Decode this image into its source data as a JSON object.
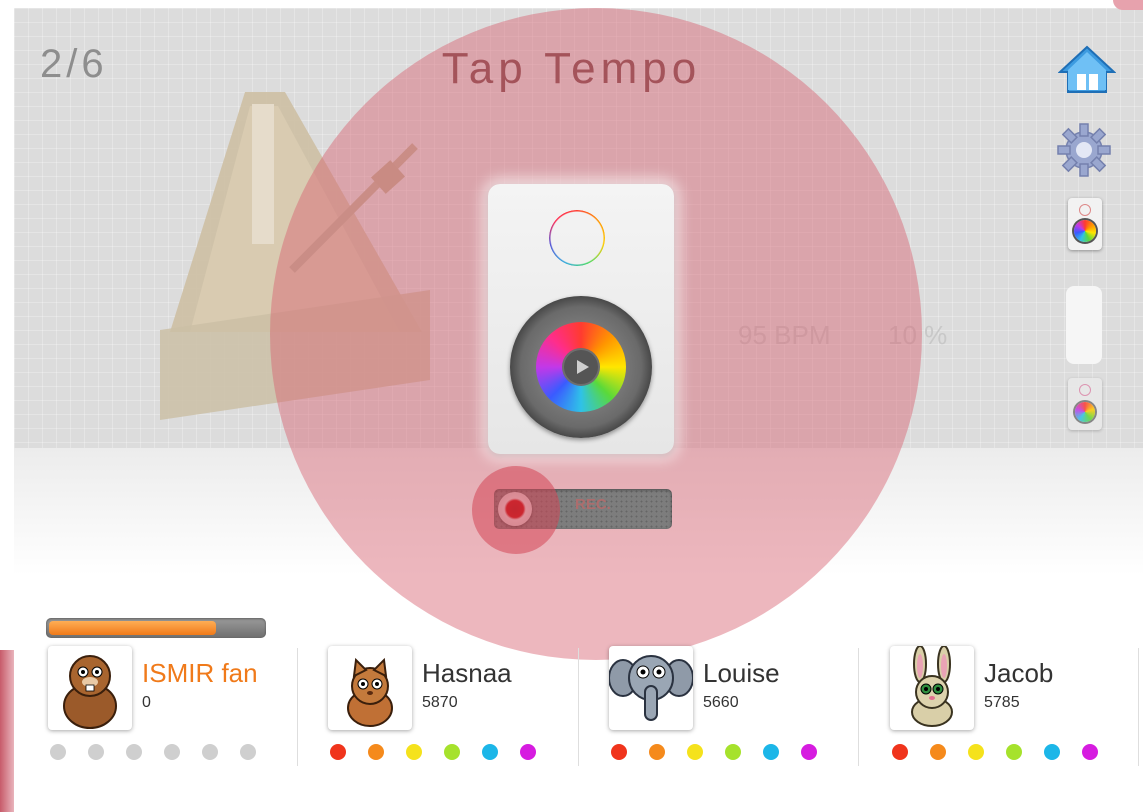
{
  "header": {
    "counter": "2/6",
    "title": "Tap Tempo"
  },
  "stage": {
    "bpm": "95 BPM",
    "accuracy": "10 %"
  },
  "recorder": {
    "label": "REC."
  },
  "sidebar": {
    "icons": [
      "home-icon",
      "gear-icon",
      "speaker-icon",
      "speaker-icon"
    ]
  },
  "colors": {
    "overlay": "#d75f6e",
    "progress_fill": "#f07a1a",
    "active_player": "#f07a1a",
    "dot_palette": [
      "#f0341c",
      "#f58a1c",
      "#f5e21c",
      "#a6e22c",
      "#1cb6e8",
      "#d61ce0"
    ],
    "dot_inactive": "#cfcfcf"
  },
  "current_player_progress": 0.78,
  "players": [
    {
      "name": "ISMIR fan",
      "score": "0",
      "avatar": "beaver-avatar",
      "active": true
    },
    {
      "name": "Hasnaa",
      "score": "5870",
      "avatar": "cat-avatar",
      "active": false
    },
    {
      "name": "Louise",
      "score": "5660",
      "avatar": "elephant-avatar",
      "active": false
    },
    {
      "name": "Jacob",
      "score": "5785",
      "avatar": "rabbit-avatar",
      "active": false
    }
  ]
}
